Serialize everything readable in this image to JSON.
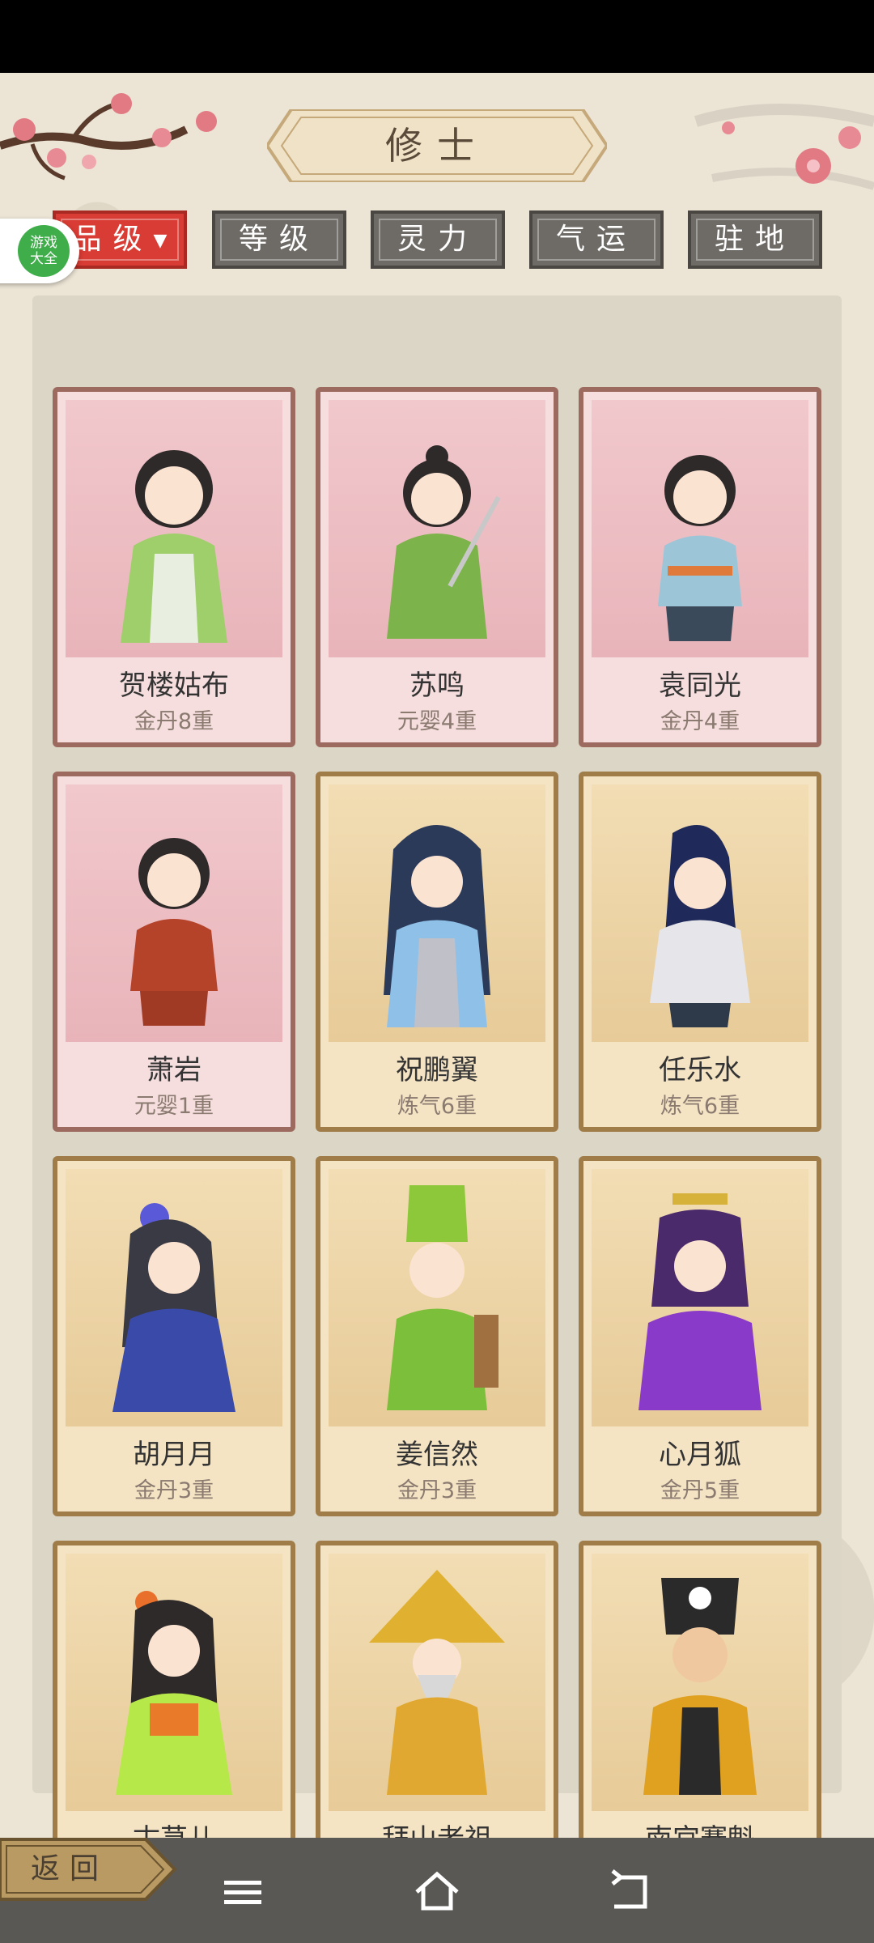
{
  "header": {
    "title": "修士"
  },
  "tabs": [
    {
      "label": "品级",
      "active": true,
      "indicator": "▼"
    },
    {
      "label": "等级",
      "active": false
    },
    {
      "label": "灵力",
      "active": false
    },
    {
      "label": "气运",
      "active": false
    },
    {
      "label": "驻地",
      "active": false
    }
  ],
  "floating_icon": {
    "label_line1": "游戏",
    "label_line2": "大全"
  },
  "cards": [
    {
      "name": "贺楼姑布",
      "level": "金丹8重",
      "tier": "pink"
    },
    {
      "name": "苏鸣",
      "level": "元婴4重",
      "tier": "pink"
    },
    {
      "name": "袁同光",
      "level": "金丹4重",
      "tier": "pink"
    },
    {
      "name": "萧岩",
      "level": "元婴1重",
      "tier": "pink"
    },
    {
      "name": "祝鹏翼",
      "level": "炼气6重",
      "tier": "tan"
    },
    {
      "name": "任乐水",
      "level": "炼气6重",
      "tier": "tan"
    },
    {
      "name": "胡月月",
      "level": "金丹3重",
      "tier": "tan"
    },
    {
      "name": "姜信然",
      "level": "金丹3重",
      "tier": "tan"
    },
    {
      "name": "心月狐",
      "level": "金丹5重",
      "tier": "tan"
    },
    {
      "name": "古荨儿",
      "level": "",
      "tier": "tan"
    },
    {
      "name": "拜山老祖",
      "level": "",
      "tier": "tan"
    },
    {
      "name": "南宫骞魁",
      "level": "",
      "tier": "tan"
    }
  ],
  "footer": {
    "back_label": "返回"
  },
  "colors": {
    "active_tab": "#d83c34",
    "inactive_tab": "#6e6a66",
    "pink_card": "#f6dede",
    "tan_card": "#f4e4c4"
  }
}
